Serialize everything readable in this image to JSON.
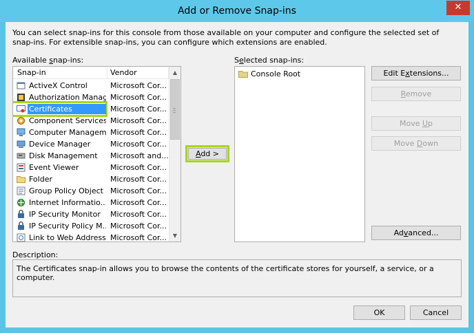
{
  "window": {
    "title": "Add or Remove Snap-ins",
    "close_glyph": "✕"
  },
  "intro_text": "You can select snap-ins for this console from those available on your computer and configure the selected set of snap-ins. For extensible snap-ins, you can configure which extensions are enabled.",
  "available": {
    "label_pre": "Available ",
    "label_key": "s",
    "label_post": "nap-ins:",
    "columns": [
      "Snap-in",
      "Vendor"
    ],
    "rows": [
      {
        "name": "ActiveX Control",
        "vendor": "Microsoft Cor...",
        "icon": "activex-icon"
      },
      {
        "name": "Authorization Manager",
        "vendor": "Microsoft Cor...",
        "icon": "authorization-icon"
      },
      {
        "name": "Certificates",
        "vendor": "Microsoft Cor...",
        "icon": "certificate-icon",
        "selected": true
      },
      {
        "name": "Component Services",
        "vendor": "Microsoft Cor...",
        "icon": "component-services-icon"
      },
      {
        "name": "Computer Managem...",
        "vendor": "Microsoft Cor...",
        "icon": "computer-management-icon"
      },
      {
        "name": "Device Manager",
        "vendor": "Microsoft Cor...",
        "icon": "device-manager-icon"
      },
      {
        "name": "Disk Management",
        "vendor": "Microsoft and...",
        "icon": "disk-icon"
      },
      {
        "name": "Event Viewer",
        "vendor": "Microsoft Cor...",
        "icon": "event-viewer-icon"
      },
      {
        "name": "Folder",
        "vendor": "Microsoft Cor...",
        "icon": "folder-icon"
      },
      {
        "name": "Group Policy Object ...",
        "vendor": "Microsoft Cor...",
        "icon": "group-policy-icon"
      },
      {
        "name": "Internet Informatio...",
        "vendor": "Microsoft Cor...",
        "icon": "iis-icon"
      },
      {
        "name": "IP Security Monitor",
        "vendor": "Microsoft Cor...",
        "icon": "ip-security-icon"
      },
      {
        "name": "IP Security Policy M...",
        "vendor": "Microsoft Cor...",
        "icon": "ip-security-icon"
      },
      {
        "name": "Link to Web Address",
        "vendor": "Microsoft Cor...",
        "icon": "web-link-icon"
      }
    ]
  },
  "add_button": {
    "key": "A",
    "rest": "dd >"
  },
  "selected_snapins": {
    "label_pre": "S",
    "label_key": "e",
    "label_post": "lected snap-ins:",
    "items": [
      {
        "name": "Console Root",
        "icon": "folder-icon"
      }
    ]
  },
  "buttons": {
    "edit_ext": {
      "pre": "Edit E",
      "key": "x",
      "post": "tensions..."
    },
    "remove": {
      "pre": "",
      "key": "R",
      "post": "emove"
    },
    "move_up": {
      "pre": "Move ",
      "key": "U",
      "post": "p"
    },
    "move_down": {
      "pre": "Move ",
      "key": "D",
      "post": "own"
    },
    "advanced": {
      "pre": "Ad",
      "key": "v",
      "post": "anced..."
    },
    "ok": "OK",
    "cancel": "Cancel"
  },
  "description": {
    "label": "Description:",
    "text": "The Certificates snap-in allows you to browse the contents of the certificate stores for yourself, a service, or a computer."
  },
  "colors": {
    "title_bar": "#5ec8ea",
    "close": "#c7392e",
    "selection": "#3399ff",
    "highlight": "#a9d619"
  }
}
